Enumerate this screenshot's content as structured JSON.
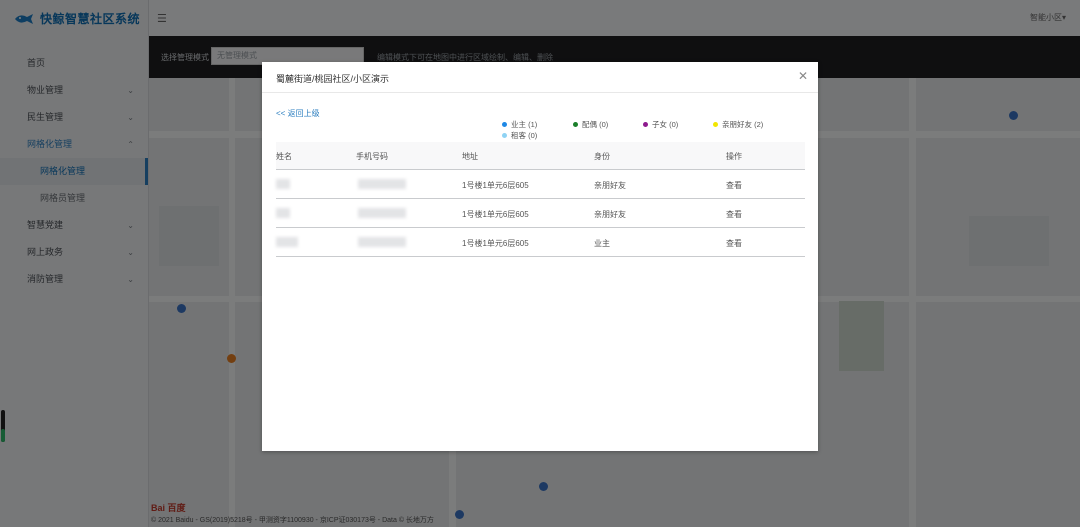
{
  "app": {
    "title": "快鲸智慧社区系统",
    "user_menu": "智能小区▾"
  },
  "sidebar": {
    "items": [
      {
        "label": "首页",
        "chevron": ""
      },
      {
        "label": "物业管理",
        "chevron": "⌄"
      },
      {
        "label": "民生管理",
        "chevron": "⌄"
      },
      {
        "label": "网格化管理",
        "chevron": "⌃"
      },
      {
        "label": "网格化管理",
        "chevron": ""
      },
      {
        "label": "网格员管理",
        "chevron": ""
      },
      {
        "label": "智慧党建",
        "chevron": "⌄"
      },
      {
        "label": "网上政务",
        "chevron": "⌄"
      },
      {
        "label": "消防管理",
        "chevron": "⌄"
      }
    ],
    "level_fraction": 0.4
  },
  "map_toolbar": {
    "mode_label": "选择管理模式",
    "mode_placeholder": "无管理模式",
    "hint": "编辑模式下可在地图中进行区域绘制、编辑、删除"
  },
  "map": {
    "credit": "© 2021 Baidu - GS(2019)5218号 - 甲测资字1100930 - 京ICP证030173号 - Data © 长地万方",
    "brand": "Bai 百度"
  },
  "modal": {
    "title": "蜀麓街道/桃园社区/小区演示",
    "back_link": "<< 返回上级",
    "legend": [
      {
        "label": "业主 (1)",
        "color": "#1e88e5"
      },
      {
        "label": "配偶 (0)",
        "color": "#1b7f2a"
      },
      {
        "label": "子女 (0)",
        "color": "#8e1b8e"
      },
      {
        "label": "亲朋好友 (2)",
        "color": "#f2e600"
      },
      {
        "label": "租客 (0)",
        "color": "#8fd3f4"
      }
    ],
    "table": {
      "headers": [
        "姓名",
        "手机号码",
        "地址",
        "身份",
        "操作"
      ],
      "rows": [
        {
          "address": "1号楼1单元6层605",
          "identity": "亲朋好友",
          "action": "查看"
        },
        {
          "address": "1号楼1单元6层605",
          "identity": "亲朋好友",
          "action": "查看"
        },
        {
          "address": "1号楼1单元6层605",
          "identity": "业主",
          "action": "查看"
        }
      ]
    }
  }
}
